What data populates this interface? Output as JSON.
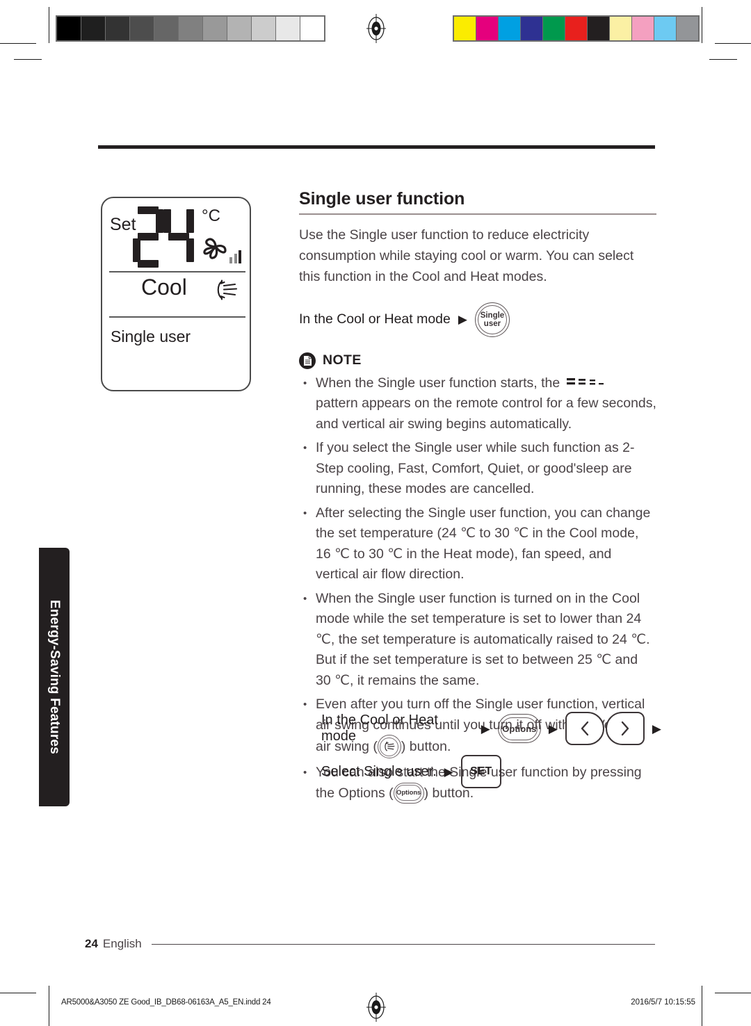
{
  "print_marks": {
    "gray_wedge": [
      "#000000",
      "#1f1f1f",
      "#333333",
      "#4d4d4d",
      "#666666",
      "#808080",
      "#999999",
      "#b3b3b3",
      "#cccccc",
      "#e8e8e8",
      "#ffffff"
    ],
    "color_bar": [
      "#fbec00",
      "#e5007d",
      "#00a0e2",
      "#2e3192",
      "#00994d",
      "#e8201d",
      "#231f20",
      "#fbf0a4",
      "#f4a0c0",
      "#6dcaf2",
      "#939598"
    ],
    "slug_file": "AR5000&A3050 ZE Good_IB_DB68-06163A_A5_EN.indd   24",
    "slug_time": "2016/5/7   10:15:55"
  },
  "side_tab": {
    "label": "Energy-Saving Features"
  },
  "lcd": {
    "set_label": "Set",
    "temperature": "24",
    "unit": "°C",
    "mode": "Cool",
    "function": "Single user",
    "fan_icon": "fan-icon",
    "fan_speed_bars": 3,
    "swing_icon": "vertical-air-swing-icon"
  },
  "content": {
    "title": "Single user function",
    "intro": "Use the Single user function to reduce electricity consumption while staying cool or warm. You can select this function in the Cool and Heat modes.",
    "step_prefix": "In the Cool or Heat mode",
    "arrow": "▶",
    "single_user_button": {
      "line1": "Single",
      "line2": "user"
    },
    "note_label": "NOTE",
    "notes": {
      "n1_before": "When the Single user function starts, the",
      "n1_after": "pattern appears on the remote control for a few seconds, and vertical air swing begins automatically.",
      "n2": "If you select the Single user while such function as 2-Step cooling, Fast, Comfort, Quiet, or good'sleep are running, these modes are cancelled.",
      "n3": "After selecting the Single user function, you can change the set temperature (24 ℃ to 30 ℃ in the Cool mode, 16 ℃ to 30 ℃ in the Heat mode), fan speed, and vertical air flow direction.",
      "n4": "When the Single user function is turned on in the Cool mode while the set temperature is set to lower than 24 ℃, the set temperature is automatically raised to 24 ℃. But if the set temperature is set to between 25 ℃ and 30 ℃, it remains the same.",
      "n5_before": "Even after you turn off the Single user function, vertical air swing continues until you turn it off with the Vertical air swing (",
      "n5_after": ") button.",
      "n6_before": "You can also start the Single user function by pressing the Options (",
      "n6_after": ") button.",
      "options_cap": "Options"
    }
  },
  "sequence": {
    "row1_label": "In the Cool or Heat mode",
    "row1_arrow1": "▶",
    "row1_options": "Options",
    "row1_arrow2": "▶",
    "row1_arrow3": "▶",
    "row2_label": "Select Single user.",
    "row2_arrow": "▶",
    "row2_set": "SET"
  },
  "footer": {
    "page_number": "24",
    "language": "English"
  }
}
